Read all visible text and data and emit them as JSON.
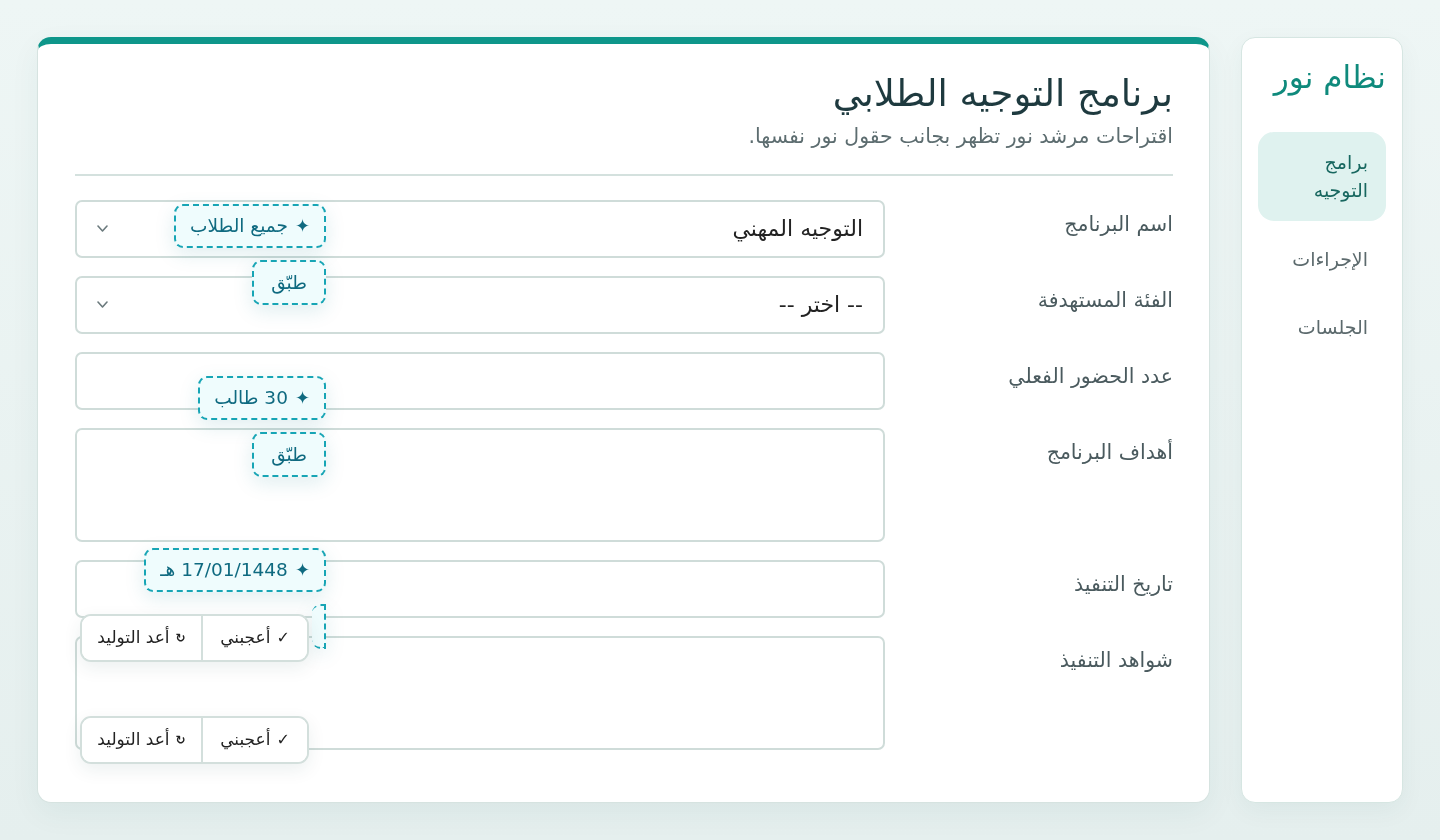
{
  "sidebar": {
    "title": "نظام نور",
    "items": [
      {
        "label": "برامج التوجيه",
        "selected": true
      },
      {
        "label": "الإجراءات",
        "selected": false
      },
      {
        "label": "الجلسات",
        "selected": false
      }
    ]
  },
  "page": {
    "title": "برنامج التوجيه الطلابي",
    "subtitle": "اقتراحات مرشد نور تظهر بجانب حقول نور نفسها."
  },
  "fields": [
    {
      "label": "اسم البرنامج",
      "kind": "select",
      "value": "التوجيه المهني"
    },
    {
      "label": "الفئة المستهدفة",
      "kind": "select",
      "value": "-- اختر --",
      "suggestion": {
        "icon": "✦",
        "text": "جميع الطلاب",
        "apply": {
          "label": "طبّق",
          "covered": false
        }
      }
    },
    {
      "label": "عدد الحضور الفعلي",
      "kind": "input",
      "suggestion": {
        "icon": "✦",
        "text": "30 طالب",
        "apply": {
          "label": "طبّق",
          "covered": false
        }
      }
    },
    {
      "label": "أهداف البرنامج",
      "kind": "textarea"
    },
    {
      "label": "تاريخ التنفيذ",
      "kind": "input",
      "suggestion": {
        "icon": "✦",
        "text": "17/01/1448 هـ",
        "apply": {
          "covered": true
        }
      },
      "feedback": [
        {
          "kind": "like",
          "icon": "✓",
          "label": "أعجبني"
        },
        {
          "kind": "regenerate",
          "icon": "↻",
          "label": "أعد التوليد"
        }
      ]
    },
    {
      "label": "شواهد التنفيذ",
      "kind": "textarea",
      "feedback": [
        {
          "kind": "like",
          "icon": "✓",
          "label": "أعجبني"
        },
        {
          "kind": "regenerate",
          "icon": "↻",
          "label": "أعد التوليد"
        }
      ]
    }
  ]
}
